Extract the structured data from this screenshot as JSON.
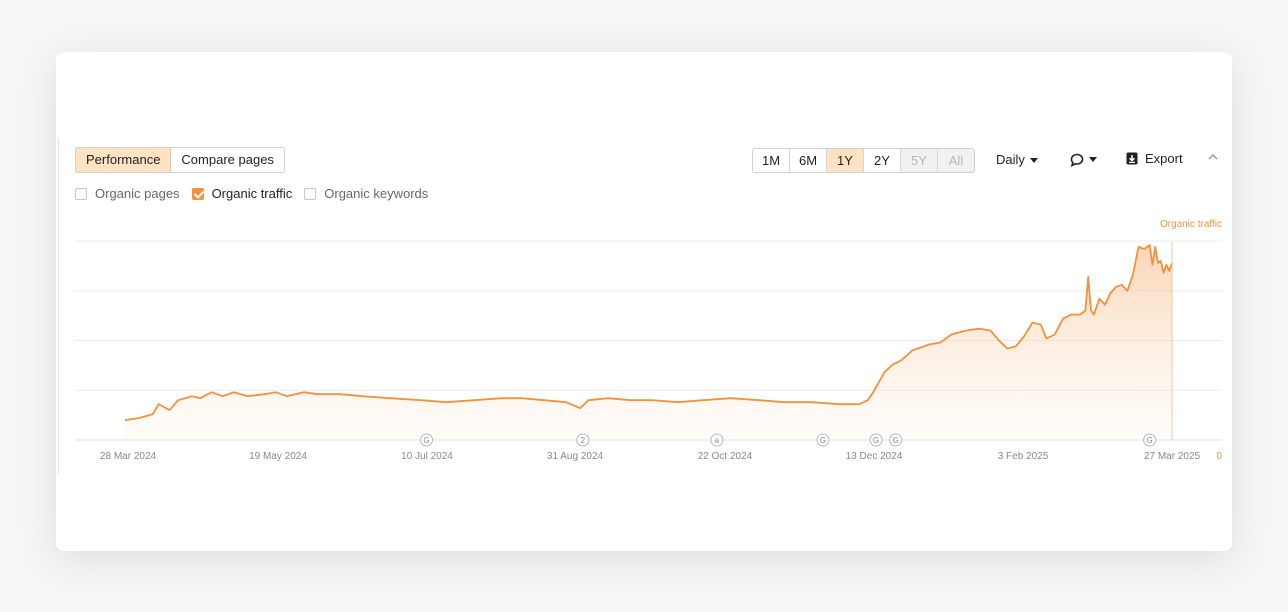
{
  "toolbar": {
    "tabs": [
      {
        "label": "Performance",
        "active": true
      },
      {
        "label": "Compare pages",
        "active": false
      }
    ],
    "ranges": [
      {
        "label": "1M",
        "state": "normal"
      },
      {
        "label": "6M",
        "state": "normal"
      },
      {
        "label": "1Y",
        "state": "active"
      },
      {
        "label": "2Y",
        "state": "normal"
      },
      {
        "label": "5Y",
        "state": "disabled"
      },
      {
        "label": "All",
        "state": "disabled"
      }
    ],
    "interval_label": "Daily",
    "export_label": "Export"
  },
  "metrics": [
    {
      "label": "Organic pages",
      "checked": false
    },
    {
      "label": "Organic traffic",
      "checked": true
    },
    {
      "label": "Organic keywords",
      "checked": false
    }
  ],
  "colors": {
    "accent": "#f0923e",
    "accent_light": "#fde3c4"
  },
  "chart_data": {
    "type": "area",
    "series": [
      {
        "name": "Organic traffic",
        "color": "#f0923e"
      }
    ],
    "y_axis_title": "Organic traffic",
    "y_axis_zero_label": "0",
    "ylim": [
      0,
      1
    ],
    "y_gridlines": 4,
    "x_ticks": [
      "28 Mar 2024",
      "19 May 2024",
      "10 Jul 2024",
      "31 Aug 2024",
      "22 Oct 2024",
      "13 Dec 2024",
      "3 Feb 2025",
      "27 Mar 2025"
    ],
    "x_range": [
      "2024-03-17",
      "2025-03-27"
    ],
    "points": [
      [
        "2024-03-17",
        0.1
      ],
      [
        "2024-03-22",
        0.11
      ],
      [
        "2024-03-27",
        0.13
      ],
      [
        "2024-03-29",
        0.18
      ],
      [
        "2024-04-02",
        0.15
      ],
      [
        "2024-04-05",
        0.2
      ],
      [
        "2024-04-10",
        0.22
      ],
      [
        "2024-04-13",
        0.21
      ],
      [
        "2024-04-17",
        0.24
      ],
      [
        "2024-04-21",
        0.22
      ],
      [
        "2024-04-25",
        0.24
      ],
      [
        "2024-04-30",
        0.22
      ],
      [
        "2024-05-06",
        0.23
      ],
      [
        "2024-05-10",
        0.24
      ],
      [
        "2024-05-14",
        0.22
      ],
      [
        "2024-05-20",
        0.24
      ],
      [
        "2024-05-25",
        0.23
      ],
      [
        "2024-06-02",
        0.23
      ],
      [
        "2024-06-10",
        0.22
      ],
      [
        "2024-06-20",
        0.21
      ],
      [
        "2024-07-01",
        0.2
      ],
      [
        "2024-07-10",
        0.19
      ],
      [
        "2024-07-20",
        0.2
      ],
      [
        "2024-07-30",
        0.21
      ],
      [
        "2024-08-06",
        0.21
      ],
      [
        "2024-08-14",
        0.2
      ],
      [
        "2024-08-22",
        0.19
      ],
      [
        "2024-08-27",
        0.16
      ],
      [
        "2024-08-30",
        0.2
      ],
      [
        "2024-09-06",
        0.21
      ],
      [
        "2024-09-14",
        0.2
      ],
      [
        "2024-09-22",
        0.2
      ],
      [
        "2024-10-01",
        0.19
      ],
      [
        "2024-10-10",
        0.2
      ],
      [
        "2024-10-20",
        0.21
      ],
      [
        "2024-10-30",
        0.2
      ],
      [
        "2024-11-08",
        0.19
      ],
      [
        "2024-11-18",
        0.19
      ],
      [
        "2024-11-28",
        0.18
      ],
      [
        "2024-12-05",
        0.18
      ],
      [
        "2024-12-08",
        0.2
      ],
      [
        "2024-12-10",
        0.24
      ],
      [
        "2024-12-12",
        0.29
      ],
      [
        "2024-12-14",
        0.34
      ],
      [
        "2024-12-17",
        0.38
      ],
      [
        "2024-12-20",
        0.4
      ],
      [
        "2024-12-24",
        0.45
      ],
      [
        "2024-12-30",
        0.48
      ],
      [
        "2025-01-03",
        0.49
      ],
      [
        "2025-01-07",
        0.53
      ],
      [
        "2025-01-12",
        0.55
      ],
      [
        "2025-01-17",
        0.56
      ],
      [
        "2025-01-21",
        0.55
      ],
      [
        "2025-01-24",
        0.5
      ],
      [
        "2025-01-27",
        0.46
      ],
      [
        "2025-01-30",
        0.47
      ],
      [
        "2025-02-02",
        0.52
      ],
      [
        "2025-02-05",
        0.59
      ],
      [
        "2025-02-08",
        0.58
      ],
      [
        "2025-02-10",
        0.51
      ],
      [
        "2025-02-13",
        0.53
      ],
      [
        "2025-02-16",
        0.61
      ],
      [
        "2025-02-19",
        0.63
      ],
      [
        "2025-02-22",
        0.63
      ],
      [
        "2025-02-24",
        0.65
      ],
      [
        "2025-02-25",
        0.82
      ],
      [
        "2025-02-26",
        0.65
      ],
      [
        "2025-02-27",
        0.63
      ],
      [
        "2025-03-01",
        0.71
      ],
      [
        "2025-03-03",
        0.68
      ],
      [
        "2025-03-05",
        0.74
      ],
      [
        "2025-03-07",
        0.77
      ],
      [
        "2025-03-09",
        0.78
      ],
      [
        "2025-03-11",
        0.75
      ],
      [
        "2025-03-13",
        0.83
      ],
      [
        "2025-03-15",
        0.97
      ],
      [
        "2025-03-17",
        0.96
      ],
      [
        "2025-03-19",
        0.98
      ],
      [
        "2025-03-20",
        0.88
      ],
      [
        "2025-03-21",
        0.97
      ],
      [
        "2025-03-22",
        0.89
      ],
      [
        "2025-03-23",
        0.9
      ],
      [
        "2025-03-24",
        0.84
      ],
      [
        "2025-03-25",
        0.88
      ],
      [
        "2025-03-26",
        0.85
      ],
      [
        "2025-03-27",
        0.89
      ]
    ],
    "annotations": [
      {
        "date": "2024-07-03",
        "label": "G"
      },
      {
        "date": "2024-08-28",
        "label": "2"
      },
      {
        "date": "2024-10-15",
        "label": "a"
      },
      {
        "date": "2024-11-22",
        "label": "G"
      },
      {
        "date": "2024-12-11",
        "label": "G"
      },
      {
        "date": "2024-12-18",
        "label": "G"
      },
      {
        "date": "2025-03-19",
        "label": "G"
      }
    ]
  }
}
